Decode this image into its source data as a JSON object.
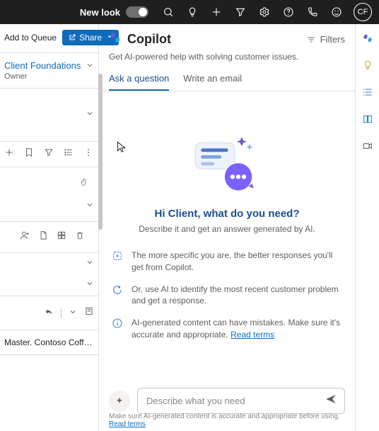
{
  "topbar": {
    "newlook_label": "New look",
    "avatar_initials": "CF"
  },
  "left": {
    "add_to_queue": "Add to Queue",
    "share": "Share",
    "owner_name": "Client Foundations",
    "owner_role": "Owner",
    "breadcrumb": "Master. Contoso Coffe..."
  },
  "copilot": {
    "title": "Copilot",
    "subtitle": "Get AI-powered help with solving customer issues.",
    "filters_label": "Filters",
    "tabs": {
      "ask": "Ask a question",
      "write": "Write an email"
    },
    "greeting": "Hi Client, what do you need?",
    "greeting_sub": "Describe it and get an answer generated by AI.",
    "tips": {
      "t1": "The more specific you are, the better responses you'll get from Copilot.",
      "t2": "Or, use AI to identify the most recent customer problem and get a response.",
      "t3_a": "AI-generated content can have mistakes. Make sure it's accurate and appropriate. ",
      "t3_link": "Read terms"
    },
    "input_placeholder": "Describe what you need",
    "footer_a": "Make sure AI-generated content is accurate and appropriate before using. ",
    "footer_link": "Read terms"
  }
}
